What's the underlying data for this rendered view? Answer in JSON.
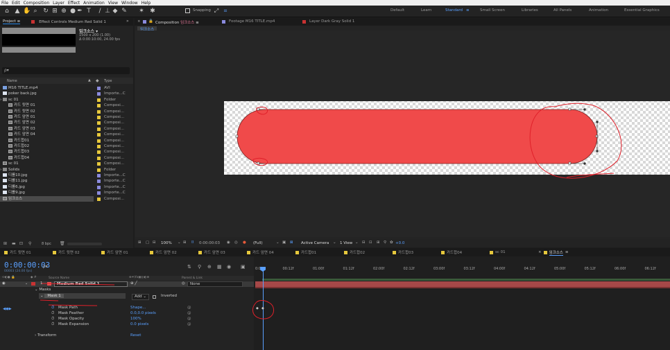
{
  "menu": [
    "File",
    "Edit",
    "Composition",
    "Layer",
    "Effect",
    "Animation",
    "View",
    "Window",
    "Help"
  ],
  "toolbar": {
    "snapping_label": "Snapping",
    "workspaces": [
      "Default",
      "Learn",
      "Standard",
      "Small Screen",
      "Libraries",
      "All Panels",
      "Animation",
      "Essential Graphics"
    ],
    "active_workspace": "Standard"
  },
  "project_panel": {
    "tab_project": "Project",
    "tab_effect_controls": "Effect Controls Medium Red Solid 1",
    "preview_name": "임크소스 ▾",
    "preview_info1": "1500 x 200 (1.00)",
    "preview_info2": "Δ 0:00:10:00, 24.00 fps",
    "search_placeholder": "ρ▾",
    "col_name": "Name",
    "col_type": "Type",
    "bpc": "8 bpc",
    "items": [
      {
        "name": "M16 TITLE.mp4",
        "type": "AVI",
        "color": "#8a8add",
        "icon": "video",
        "indent": 0
      },
      {
        "name": "poker back.jpg",
        "type": "Importe...C",
        "color": "#8a8add",
        "icon": "image",
        "indent": 0
      },
      {
        "name": "sc 01",
        "type": "Folder",
        "color": "#e6c83c",
        "icon": "folder",
        "indent": 0
      },
      {
        "name": "카드 뒷면 01",
        "type": "Composi...",
        "color": "#e6c83c",
        "icon": "comp",
        "indent": 1
      },
      {
        "name": "카드 뒷면 02",
        "type": "Composi...",
        "color": "#e6c83c",
        "icon": "comp",
        "indent": 1
      },
      {
        "name": "카드 앞면 01",
        "type": "Composi...",
        "color": "#e6c83c",
        "icon": "comp",
        "indent": 1
      },
      {
        "name": "카드 앞면 02",
        "type": "Composi...",
        "color": "#e6c83c",
        "icon": "comp",
        "indent": 1
      },
      {
        "name": "카드 앞면 03",
        "type": "Composi...",
        "color": "#e6c83c",
        "icon": "comp",
        "indent": 1
      },
      {
        "name": "카드 앞면 04",
        "type": "Composi...",
        "color": "#e6c83c",
        "icon": "comp",
        "indent": 1
      },
      {
        "name": "카드합01",
        "type": "Composi...",
        "color": "#e6c83c",
        "icon": "comp",
        "indent": 1
      },
      {
        "name": "카드합02",
        "type": "Composi...",
        "color": "#e6c83c",
        "icon": "comp",
        "indent": 1
      },
      {
        "name": "카드합03",
        "type": "Composi...",
        "color": "#e6c83c",
        "icon": "comp",
        "indent": 1
      },
      {
        "name": "카드합04",
        "type": "Composi...",
        "color": "#e6c83c",
        "icon": "comp",
        "indent": 1
      },
      {
        "name": "sc 01",
        "type": "Composi...",
        "color": "#e6c83c",
        "icon": "comp",
        "indent": 0
      },
      {
        "name": "Solids",
        "type": "Folder",
        "color": "#e6c83c",
        "icon": "folder",
        "indent": 0
      },
      {
        "name": "디롤10.jpg",
        "type": "Importe...C",
        "color": "#8a8add",
        "icon": "image",
        "indent": 0
      },
      {
        "name": "디롤11.jpg",
        "type": "Importe...C",
        "color": "#8a8add",
        "icon": "image",
        "indent": 0
      },
      {
        "name": "디롤6.jpg",
        "type": "Importe...C",
        "color": "#8a8add",
        "icon": "image",
        "indent": 0
      },
      {
        "name": "디롤9.jpg",
        "type": "Importe...C",
        "color": "#8a8add",
        "icon": "image",
        "indent": 0
      },
      {
        "name": "임크소스",
        "type": "Composi...",
        "color": "#e6c83c",
        "icon": "comp",
        "indent": 0,
        "selected": true
      }
    ]
  },
  "composition_panel": {
    "tab_comp_prefix": "Composition",
    "tab_comp_name": "임크소스",
    "tab_footage": "Footage M16 TITLE.mp4",
    "tab_layer": "Layer Dark Gray Solid 1",
    "breadcrumb": "임크소스",
    "zoom": "100%",
    "timecode": "0:00:00:03",
    "resolution": "(Full)",
    "camera": "Active Camera",
    "views": "1 View",
    "exposure": "+0.0"
  },
  "timeline": {
    "tabs": [
      "카드 뒷면 01",
      "카드 뒷면 02",
      "카드 앞면 01",
      "카드 앞면 02",
      "카드 앞면 03",
      "카드 앞면 04",
      "카드합01",
      "카드합02",
      "카드합03",
      "카드합04",
      "sc 01",
      "임크소스"
    ],
    "active_tab": "임크소스",
    "timecode": "0:00:00:03",
    "frame_info": "00003 (24.00 fps)",
    "ruler": [
      "0:00f",
      "00:12f",
      "01:00f",
      "01:12f",
      "02:00f",
      "02:12f",
      "03:00f",
      "03:12f",
      "04:00f",
      "04:12f",
      "05:00f",
      "05:12f",
      "06:00f",
      "06:12f"
    ],
    "col_source_name": "Source Name",
    "col_parent": "Parent & Link",
    "layer_number": "1",
    "layer_name": "Medium Red Solid 1",
    "parent_value": "None",
    "masks_label": "Masks",
    "mask_name": "Mask 1",
    "mask_mode": "Add",
    "mask_inverted": "Inverted",
    "properties": [
      {
        "name": "Mask Path",
        "value": "Shape..."
      },
      {
        "name": "Mask Feather",
        "value": "0.0,0.0 pixels"
      },
      {
        "name": "Mask Opacity",
        "value": "100%"
      },
      {
        "name": "Mask Expansion",
        "value": "0.0 pixels"
      }
    ],
    "transform_label": "Transform",
    "transform_value": "Reset"
  },
  "colors": {
    "accent": "#2d8ceb",
    "layer_red": "#f04a4a",
    "annotation": "#e0202a"
  }
}
